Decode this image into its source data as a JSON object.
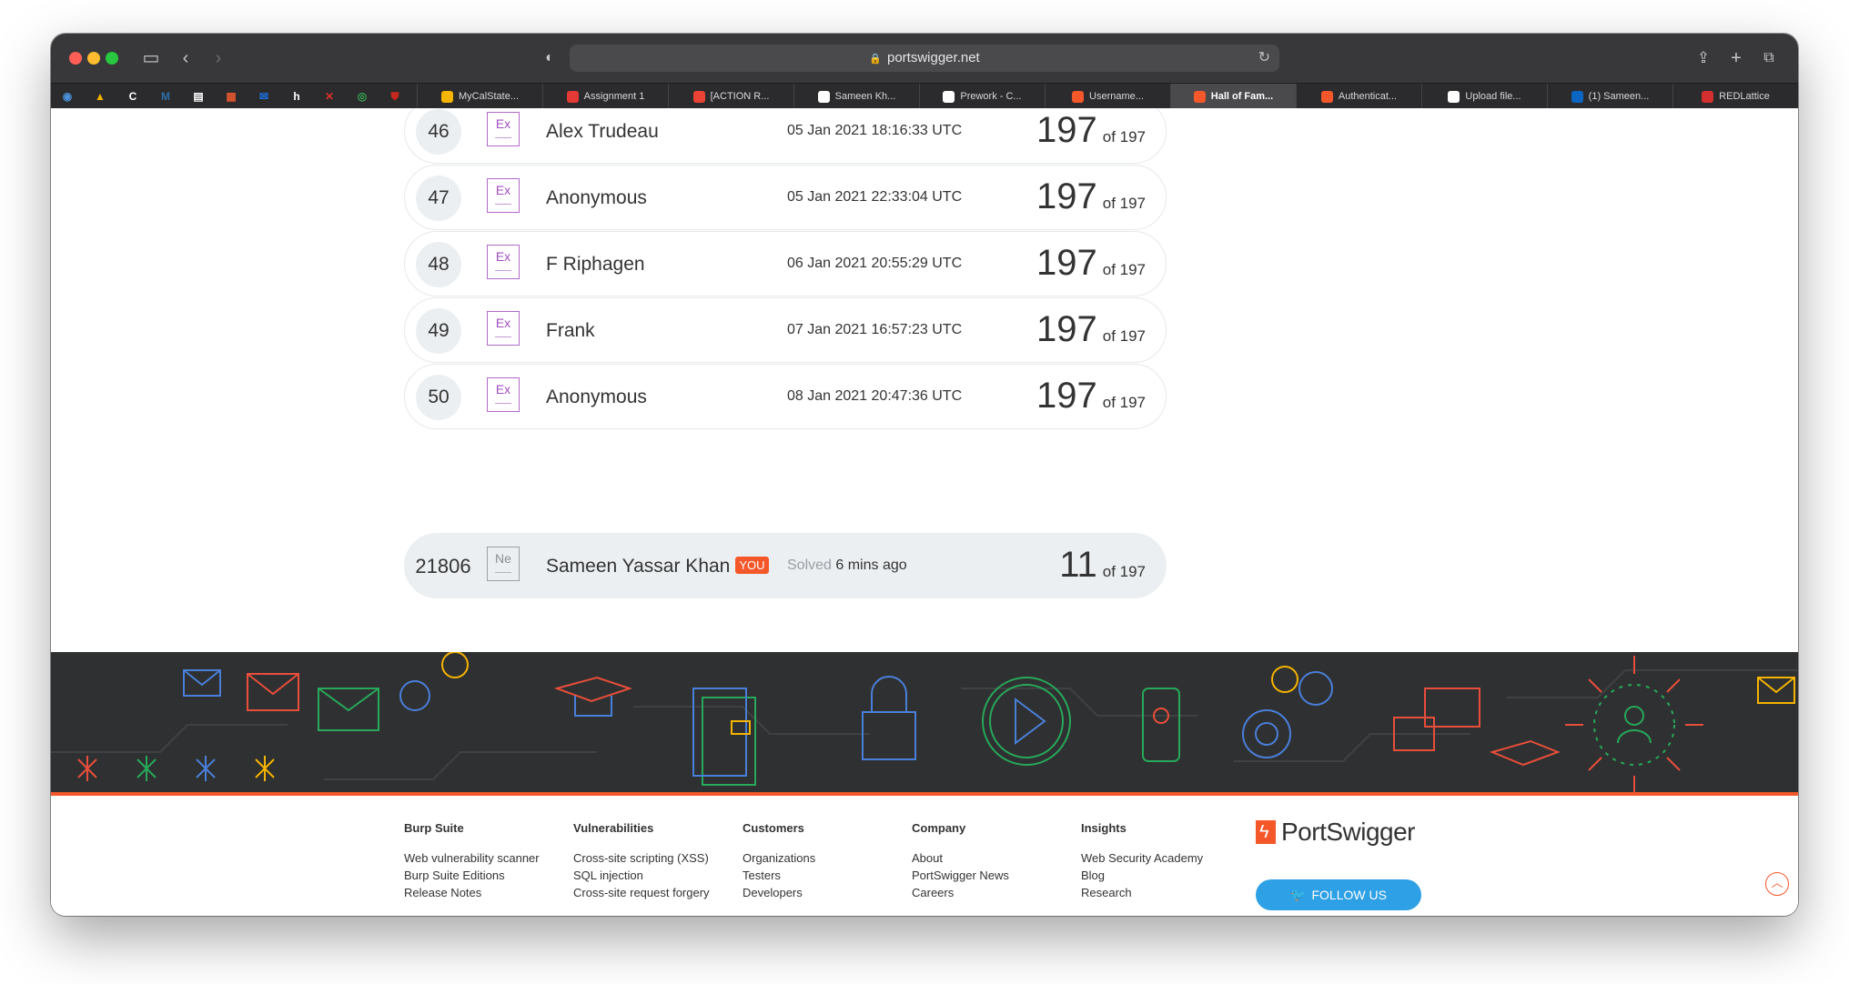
{
  "browser": {
    "url": "portswigger.net",
    "pinned_tabs": [
      {
        "icon": "globe-icon",
        "color": "#4a90d9"
      },
      {
        "icon": "drive-icon",
        "color": "#f5b400"
      },
      {
        "icon": "c-icon",
        "color": "#ffffff"
      },
      {
        "icon": "m-icon",
        "color": "#2d6ea8"
      },
      {
        "icon": "flag-icon",
        "color": "#ffffff"
      },
      {
        "icon": "grid-icon",
        "color": "#e4572e"
      },
      {
        "icon": "mail-icon",
        "color": "#1a73e8"
      },
      {
        "icon": "h-icon",
        "color": "#ffffff"
      },
      {
        "icon": "pin-icon",
        "color": "#d93025"
      },
      {
        "icon": "chrome-icon",
        "color": "#34a853"
      },
      {
        "icon": "shield-icon",
        "color": "#c5281c"
      }
    ],
    "tabs": [
      {
        "label": "MyCalState...",
        "color": "#f5b400",
        "active": false
      },
      {
        "label": "Assignment 1",
        "color": "#e53935",
        "active": false
      },
      {
        "label": "[ACTION R...",
        "color": "#ea4335",
        "active": false
      },
      {
        "label": "Sameen Kh...",
        "color": "#ffffff",
        "active": false
      },
      {
        "label": "Prework - C...",
        "color": "#ffffff",
        "active": false
      },
      {
        "label": "Username...",
        "color": "#f4572a",
        "active": false
      },
      {
        "label": "Hall of Fam...",
        "color": "#f4572a",
        "active": true
      },
      {
        "label": "Authenticat...",
        "color": "#f4572a",
        "active": false
      },
      {
        "label": "Upload file...",
        "color": "#ffffff",
        "active": false
      },
      {
        "label": "(1) Sameen...",
        "color": "#0a66c2",
        "active": false
      },
      {
        "label": "REDLattice",
        "color": "#d32f2f",
        "active": false
      }
    ]
  },
  "leaderboard": [
    {
      "rank": "46",
      "badge": "Ex",
      "name": "Alex Trudeau",
      "date": "05 Jan 2021 18:16:33 UTC",
      "score": "197",
      "of": "of 197"
    },
    {
      "rank": "47",
      "badge": "Ex",
      "name": "Anonymous",
      "date": "05 Jan 2021 22:33:04 UTC",
      "score": "197",
      "of": "of 197"
    },
    {
      "rank": "48",
      "badge": "Ex",
      "name": "F Riphagen",
      "date": "06 Jan 2021 20:55:29 UTC",
      "score": "197",
      "of": "of 197"
    },
    {
      "rank": "49",
      "badge": "Ex",
      "name": "Frank",
      "date": "07 Jan 2021 16:57:23 UTC",
      "score": "197",
      "of": "of 197"
    },
    {
      "rank": "50",
      "badge": "Ex",
      "name": "Anonymous",
      "date": "08 Jan 2021 20:47:36 UTC",
      "score": "197",
      "of": "of 197"
    }
  ],
  "current_user": {
    "rank": "21806",
    "badge": "Ne",
    "name": "Sameen Yassar Khan",
    "you_tag": "YOU",
    "solved_label": "Solved",
    "solved_time": "6 mins ago",
    "score": "11",
    "of": "of 197"
  },
  "footer": {
    "columns": [
      {
        "heading": "Burp Suite",
        "links": [
          "Web vulnerability scanner",
          "Burp Suite Editions",
          "Release Notes"
        ]
      },
      {
        "heading": "Vulnerabilities",
        "links": [
          "Cross-site scripting (XSS)",
          "SQL injection",
          "Cross-site request forgery"
        ]
      },
      {
        "heading": "Customers",
        "links": [
          "Organizations",
          "Testers",
          "Developers"
        ]
      },
      {
        "heading": "Company",
        "links": [
          "About",
          "PortSwigger News",
          "Careers"
        ]
      },
      {
        "heading": "Insights",
        "links": [
          "Web Security Academy",
          "Blog",
          "Research"
        ]
      }
    ],
    "brand": "PortSwigger",
    "follow_label": "FOLLOW US"
  },
  "colors": {
    "accent": "#f4572a",
    "expert_badge": "#a24fc0",
    "twitter": "#2ea0e6"
  }
}
